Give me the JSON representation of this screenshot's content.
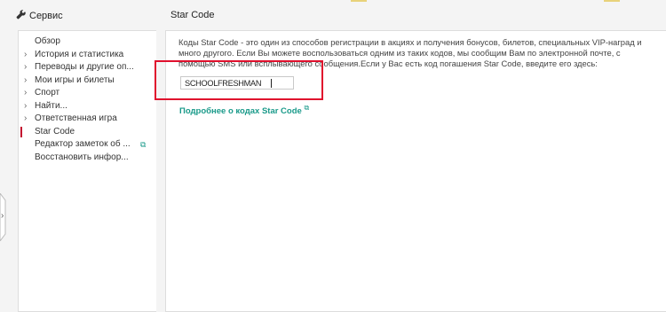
{
  "header": {
    "service_label": "Сервис",
    "page_title": "Star Code"
  },
  "sidebar": {
    "items": [
      {
        "label": "Обзор",
        "expandable": false
      },
      {
        "label": "История и статистика",
        "expandable": true
      },
      {
        "label": "Переводы и другие оп...",
        "expandable": true
      },
      {
        "label": "Мои игры и билеты",
        "expandable": true
      },
      {
        "label": "Спорт",
        "expandable": true
      },
      {
        "label": "Найти...",
        "expandable": true
      },
      {
        "label": "Ответственная игра",
        "expandable": true
      },
      {
        "label": "Star Code",
        "expandable": false,
        "active": true
      },
      {
        "label": "Редактор заметок об ...",
        "expandable": false,
        "external": true
      },
      {
        "label": "Восстановить инфор...",
        "expandable": false
      }
    ],
    "external_glyph": "⧉",
    "chevron_glyph": "›"
  },
  "main": {
    "description": "Коды Star Code - это один из способов регистрации в акциях и получения бонусов, билетов, специальных VIP-наград и много другого. Если Вы можете воспользоваться одним из таких кодов, мы сообщим Вам по электронной почте, с помощью SMS или всплывающего сообщения.Если у Вас есть код погашения Star Code, введите его здесь:",
    "code_value": "SCHOOLFRESHMAN",
    "more_link": "Подробнее о кодах Star Code",
    "more_link_glyph": "⧉"
  },
  "colors": {
    "accent_teal": "#1a9a8a",
    "highlight_red": "#e0102d",
    "active_marker": "#c41230"
  },
  "icons": {
    "service": "wrench-icon",
    "side_handle": "chevron-right-icon"
  },
  "side_handle_glyph": "›"
}
